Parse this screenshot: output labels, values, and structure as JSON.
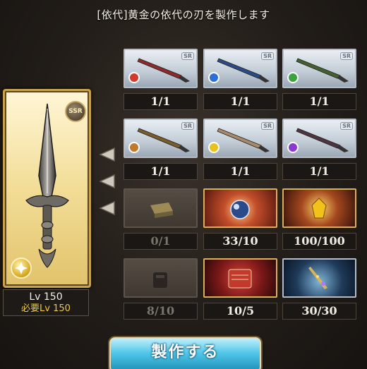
{
  "header": {
    "title": "[依代]黄金の依代の刃を製作します"
  },
  "weapon": {
    "rarity": "SSR",
    "element_icon": "light-element-icon",
    "level_label": "Lv 150",
    "required_level_label": "必要Lv 150"
  },
  "materials": [
    {
      "id": "fire-dagger",
      "icon": "fire-dagger-icon",
      "rarity": "SR",
      "count": "1/1",
      "accent": "#d23b2b",
      "blade": "#8d2a2a"
    },
    {
      "id": "water-dagger",
      "icon": "water-dagger-icon",
      "rarity": "SR",
      "count": "1/1",
      "accent": "#2d6fd6",
      "blade": "#2b4b86"
    },
    {
      "id": "wind-dagger",
      "icon": "wind-dagger-icon",
      "rarity": "SR",
      "count": "1/1",
      "accent": "#3aa33d",
      "blade": "#44602e"
    },
    {
      "id": "earth-dagger",
      "icon": "earth-dagger-icon",
      "rarity": "SR",
      "count": "1/1",
      "accent": "#c0782a",
      "blade": "#7a5b2a"
    },
    {
      "id": "light-dagger",
      "icon": "light-dagger-icon",
      "rarity": "SR",
      "count": "1/1",
      "accent": "#e8c21c",
      "blade": "#a88a6a"
    },
    {
      "id": "dark-dagger",
      "icon": "dark-dagger-icon",
      "rarity": "SR",
      "count": "1/1",
      "accent": "#8a3ad0",
      "blade": "#4e3340"
    },
    {
      "id": "gold-brick",
      "icon": "gold-brick-icon",
      "count": "0/1",
      "dim": true
    },
    {
      "id": "orb-item",
      "icon": "orb-icon",
      "count": "33/10",
      "gold": true
    },
    {
      "id": "gold-crystal",
      "icon": "gold-crystal-icon",
      "count": "100/100",
      "gold": true
    },
    {
      "id": "dark-item",
      "icon": "dark-item-icon",
      "count": "8/10",
      "dim": true
    },
    {
      "id": "scroll-item",
      "icon": "scroll-icon",
      "count": "10/5",
      "gold": true
    },
    {
      "id": "blade-item",
      "icon": "starry-blade-icon",
      "count": "30/30"
    }
  ],
  "actions": {
    "craft_label": "製作する"
  }
}
